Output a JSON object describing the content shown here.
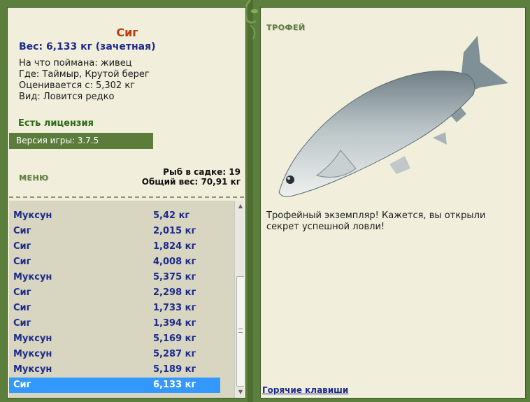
{
  "catch": {
    "fish_name": "Сиг",
    "weight": "Вес: 6,133 кг (зачетная)",
    "bait": "На что поймана: живец",
    "location": "Где: Таймыр, Крутой берег",
    "valued_from": "Оценивается с: 5,302 кг",
    "species": "Вид: Ловится редко"
  },
  "license": "Есть лицензия",
  "version": "Версия игры: 3.7.5",
  "menu": {
    "title": "МЕНЮ",
    "fish_in_net": "Рыб в садке: 19",
    "total_weight": "Общий вес: 70,91 кг"
  },
  "fish_list": [
    {
      "name": "Муксун",
      "weight": "5,42 кг"
    },
    {
      "name": "Сиг",
      "weight": "2,015 кг"
    },
    {
      "name": "Сиг",
      "weight": "1,824 кг"
    },
    {
      "name": "Сиг",
      "weight": "4,008 кг"
    },
    {
      "name": "Муксун",
      "weight": "5,375 кг"
    },
    {
      "name": "Сиг",
      "weight": "2,298 кг"
    },
    {
      "name": "Сиг",
      "weight": "1,733 кг"
    },
    {
      "name": "Сиг",
      "weight": "1,394 кг"
    },
    {
      "name": "Муксун",
      "weight": "5,169 кг"
    },
    {
      "name": "Муксун",
      "weight": "5,287 кг"
    },
    {
      "name": "Муксун",
      "weight": "5,189 кг"
    },
    {
      "name": "Сиг",
      "weight": "6,133 кг"
    }
  ],
  "selected_index": 11,
  "trophy": {
    "title": "ТРОФЕЙ",
    "text": "Трофейный экземпляр! Кажется, вы открыли секрет успешной ловли!",
    "hotkeys": "Горячие клавиши"
  },
  "colors": {
    "frame": "#5d7f3e",
    "panel_bg": "#f1efdc",
    "fish_name": "#c03a0b",
    "list_text": "#1d2a8a",
    "selection": "#3399ff"
  }
}
